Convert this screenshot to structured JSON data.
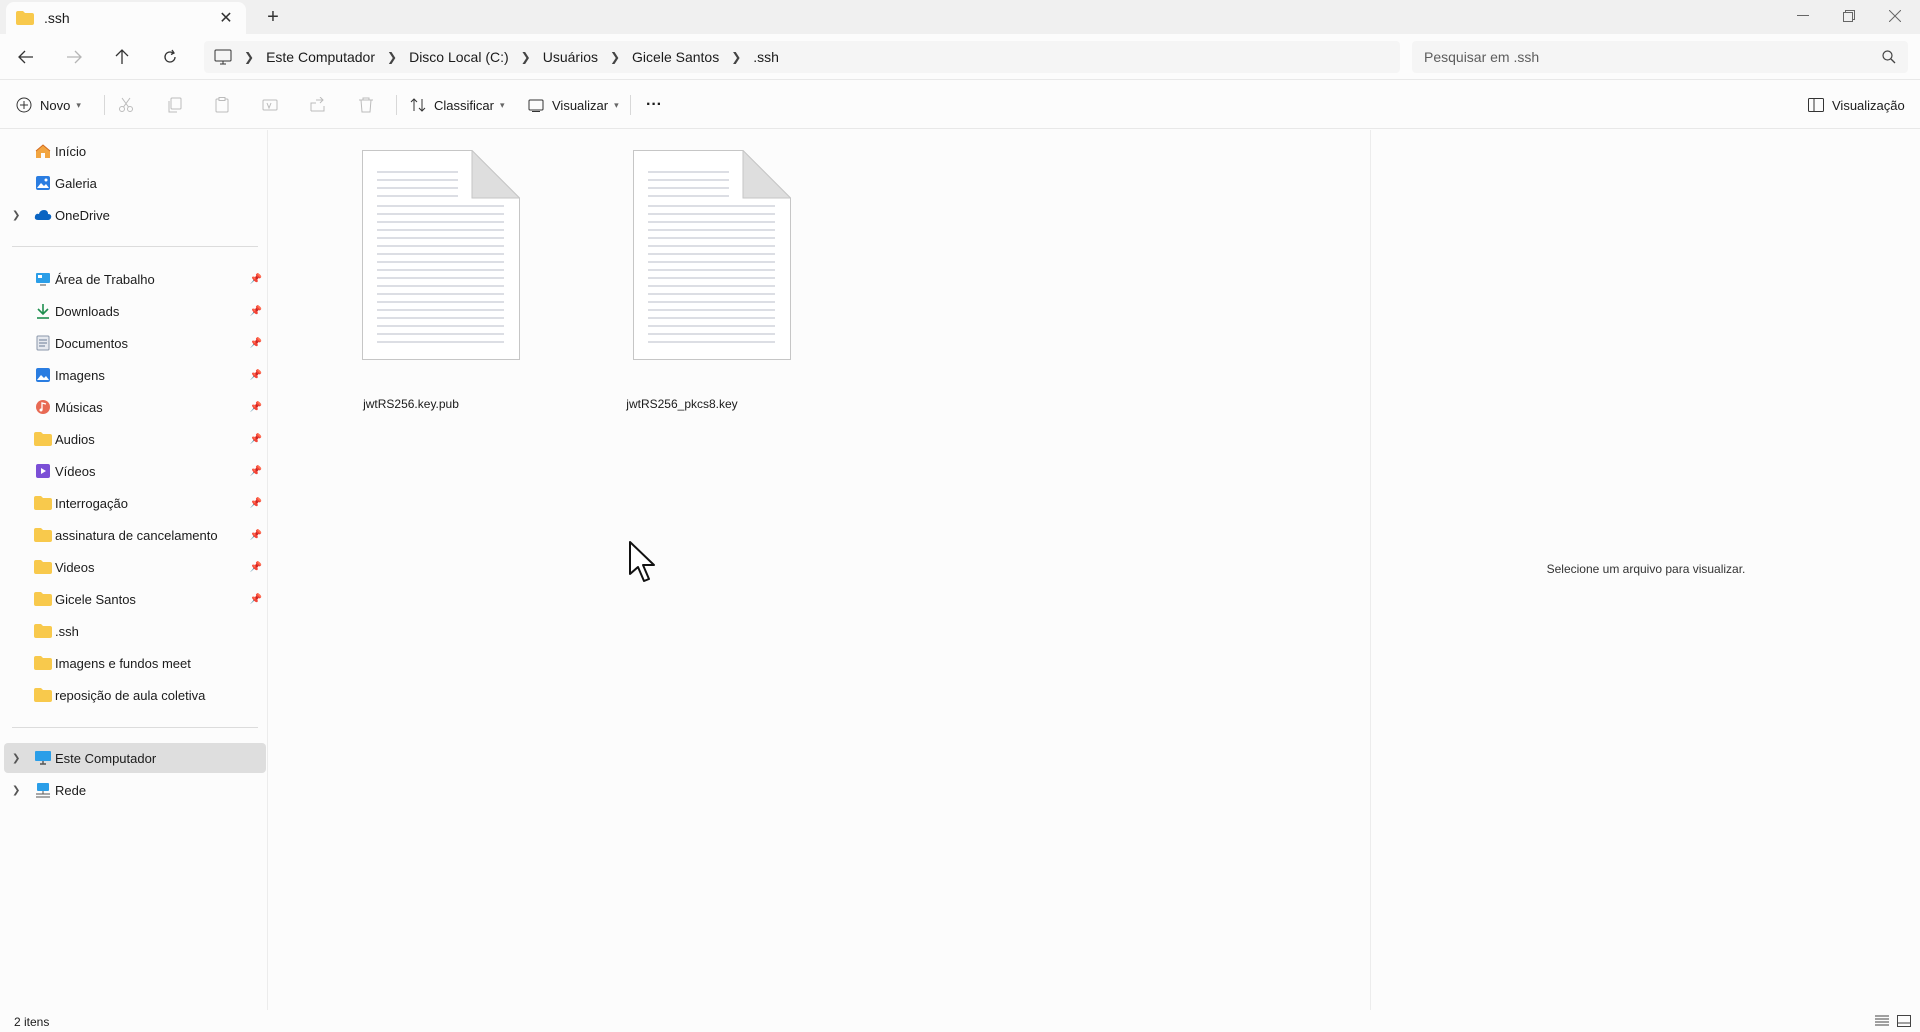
{
  "tab": {
    "title": ".ssh",
    "close": "✕",
    "new_tab": "+"
  },
  "window_controls": {
    "minimize": "—",
    "maximize": "❐",
    "close": "✕"
  },
  "breadcrumb": [
    "Este Computador",
    "Disco Local (C:)",
    "Usuários",
    "Gicele Santos",
    ".ssh"
  ],
  "search": {
    "placeholder": "Pesquisar em .ssh"
  },
  "toolbar": {
    "new_label": "Novo",
    "sort_label": "Classificar",
    "view_label": "Visualizar",
    "more_label": "···",
    "preview_label": "Visualização"
  },
  "sidebar": {
    "top": [
      {
        "label": "Início",
        "icon": "home-icon"
      },
      {
        "label": "Galeria",
        "icon": "gallery-icon"
      },
      {
        "label": "OneDrive",
        "icon": "cloud-icon"
      }
    ],
    "quick": [
      {
        "label": "Área de Trabalho",
        "icon": "desktop-icon"
      },
      {
        "label": "Downloads",
        "icon": "download-icon"
      },
      {
        "label": "Documentos",
        "icon": "document-icon"
      },
      {
        "label": "Imagens",
        "icon": "image-icon"
      },
      {
        "label": "Músicas",
        "icon": "music-icon"
      },
      {
        "label": "Audios",
        "icon": "folder-icon"
      },
      {
        "label": "Vídeos",
        "icon": "video-icon"
      },
      {
        "label": "Interrogação",
        "icon": "folder-icon"
      },
      {
        "label": "assinatura de cancelamento",
        "icon": "folder-icon"
      },
      {
        "label": "Videos",
        "icon": "folder-icon"
      },
      {
        "label": "Gicele Santos",
        "icon": "folder-icon"
      },
      {
        "label": ".ssh",
        "icon": "folder-icon"
      },
      {
        "label": "Imagens e fundos meet",
        "icon": "folder-icon"
      },
      {
        "label": "reposição de aula coletiva",
        "icon": "folder-icon"
      }
    ],
    "bottom": [
      {
        "label": "Este Computador",
        "icon": "computer-icon"
      },
      {
        "label": "Rede",
        "icon": "network-icon"
      }
    ]
  },
  "files": [
    {
      "name": "jwtRS256.key.pub"
    },
    {
      "name": "jwtRS256_pkcs8.key"
    }
  ],
  "preview": {
    "message": "Selecione um arquivo para visualizar."
  },
  "status": {
    "count": "2 itens"
  },
  "colors": {
    "folder": "#f8c94c",
    "selected": "#dedede",
    "accent": "#0a64c2"
  }
}
